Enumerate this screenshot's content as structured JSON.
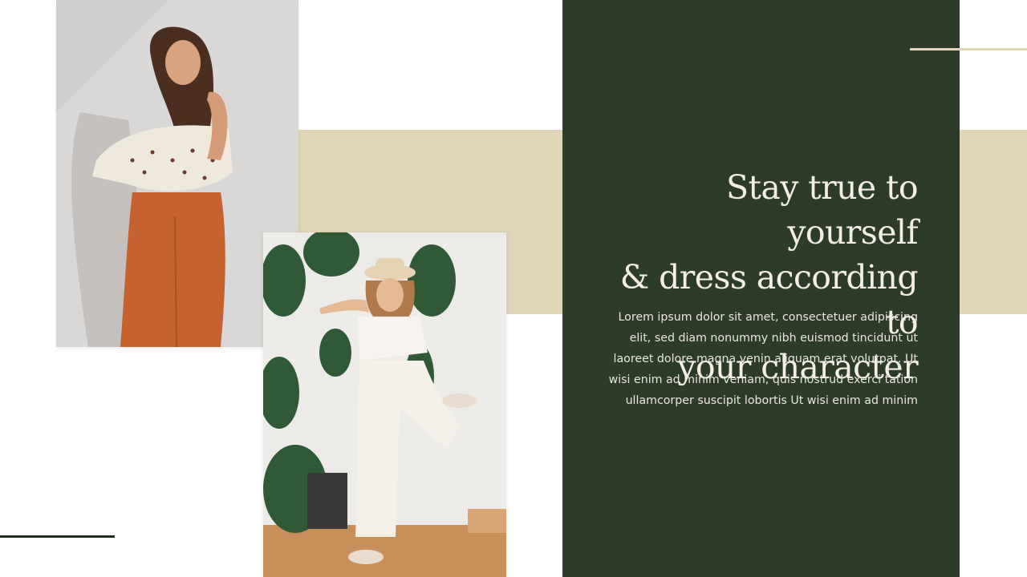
{
  "slide": {
    "heading": "Stay true to yourself\n& dress according to\nyour character",
    "body": "Lorem ipsum dolor sit amet, consectetuer adipiscing\nelit, sed diam nonummy nibh euismod tincidunt ut\nlaoreet dolore magna venin aliquam erat volutpat. Ut\nwisi enim ad minim veniam, quis nostrud exerci tation\nullamcorper suscipit lobortis  Ut wisi enim ad minim"
  },
  "colors": {
    "panel": "#2d3b29",
    "accent_beige": "#e0d5b8",
    "heading_text": "#f3efe4",
    "body_text": "#e9e6dc"
  }
}
